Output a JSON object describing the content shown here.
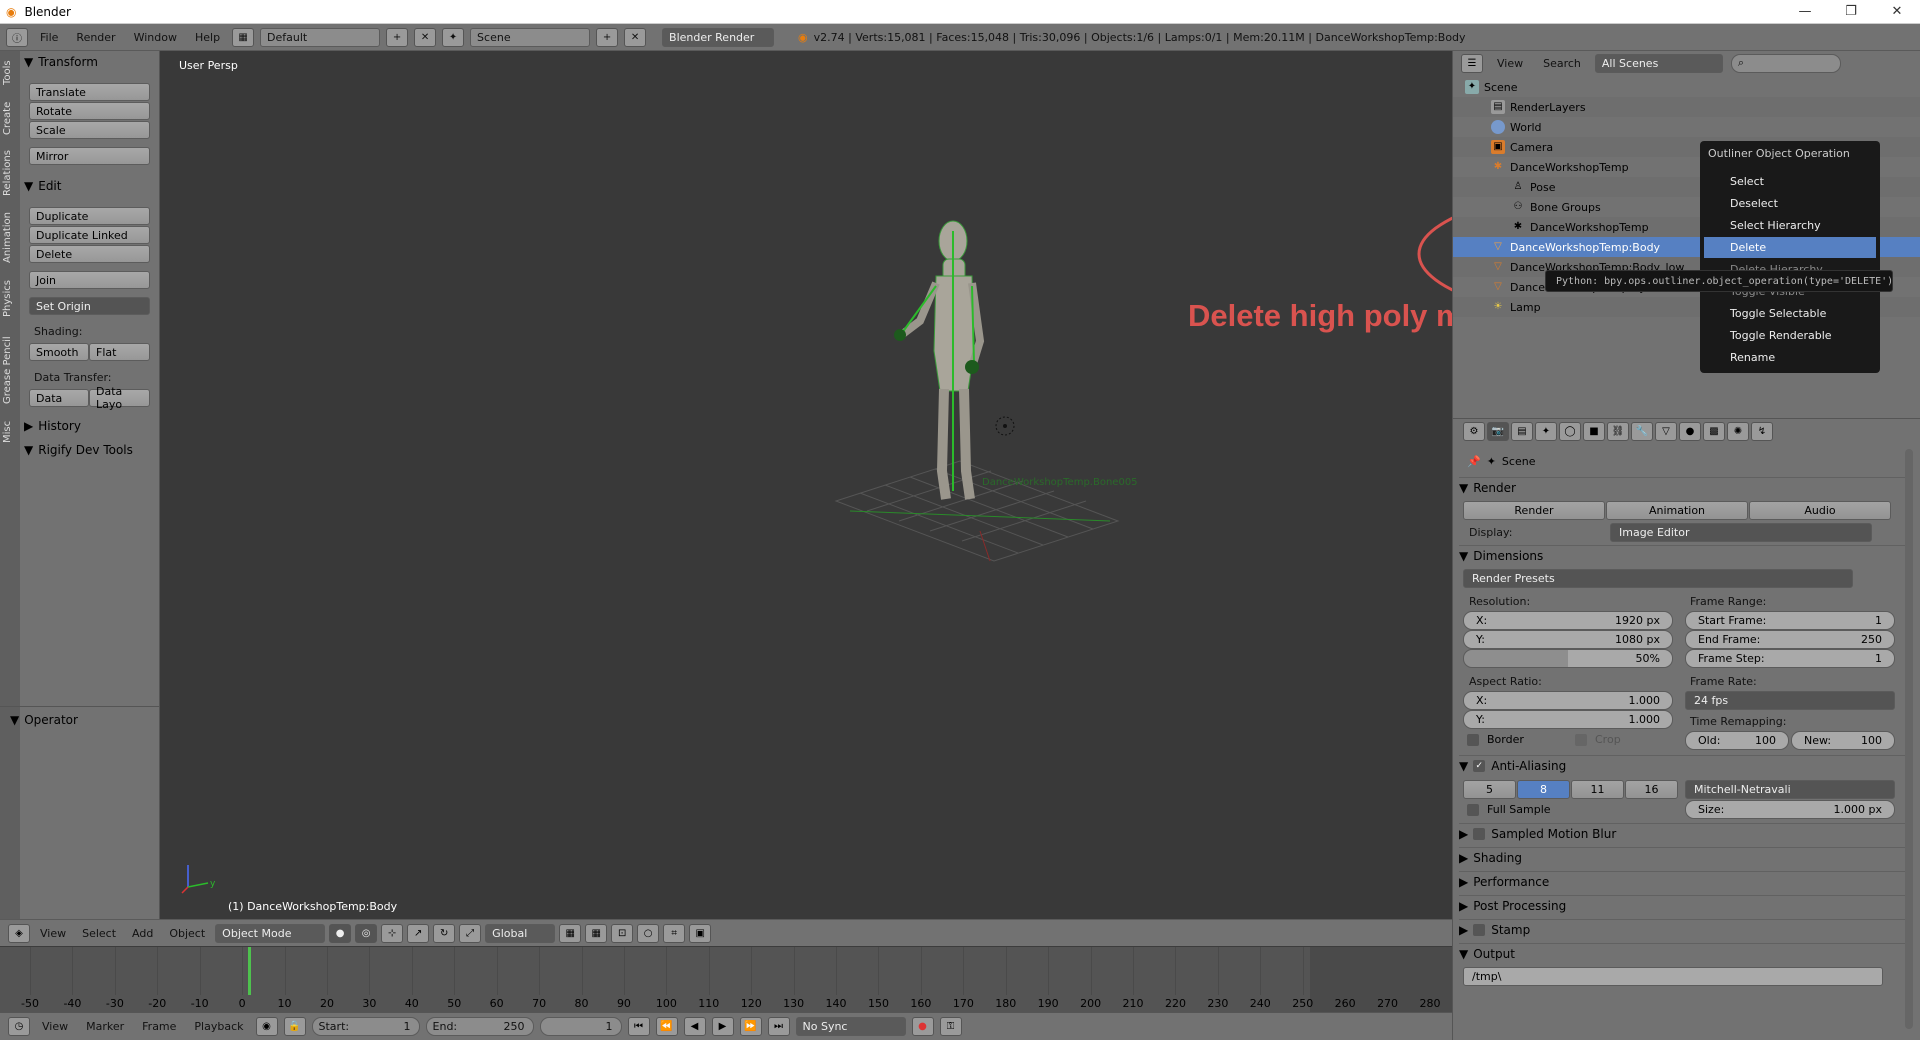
{
  "window": {
    "title": "Blender",
    "min": "—",
    "max": "❐",
    "close": "✕"
  },
  "infobar": {
    "menus": [
      "File",
      "Render",
      "Window",
      "Help"
    ],
    "layout": "Default",
    "scene": "Scene",
    "engine": "Blender Render",
    "stats": "v2.74 | Verts:15,081 | Faces:15,048 | Tris:30,096 | Objects:1/6 | Lamps:0/1 | Mem:20.11M | DanceWorkshopTemp:Body"
  },
  "toolshelf": {
    "tabs": [
      "Tools",
      "Create",
      "Relations",
      "Animation",
      "Physics",
      "Grease Pencil",
      "Misc"
    ],
    "transform": "Transform",
    "translate": "Translate",
    "rotate": "Rotate",
    "scale": "Scale",
    "mirror": "Mirror",
    "edit": "Edit",
    "duplicate": "Duplicate",
    "duplicate_linked": "Duplicate Linked",
    "delete": "Delete",
    "join": "Join",
    "set_origin": "Set Origin",
    "shading": "Shading:",
    "smooth": "Smooth",
    "flat": "Flat",
    "data_transfer": "Data Transfer:",
    "data": "Data",
    "data_layo": "Data Layo",
    "history": "History",
    "rigify": "Rigify Dev Tools",
    "operator": "Operator"
  },
  "viewport": {
    "persp": "User Persp",
    "object_label": "(1) DanceWorkshopTemp:Body",
    "annotation": "Delete high poly mesh",
    "axis_x": "x",
    "axis_y": "y",
    "axis_z": "z",
    "bone_label": "DanceWorkshopTemp.Bone005"
  },
  "vheader": {
    "view": "View",
    "select": "Select",
    "add": "Add",
    "object": "Object",
    "mode": "Object Mode",
    "orientation": "Global"
  },
  "timeline": {
    "ticks": [
      "-50",
      "-40",
      "-30",
      "-20",
      "-10",
      "0",
      "10",
      "20",
      "30",
      "40",
      "50",
      "60",
      "70",
      "80",
      "90",
      "100",
      "110",
      "120",
      "130",
      "140",
      "150",
      "160",
      "170",
      "180",
      "190",
      "200",
      "210",
      "220",
      "230",
      "240",
      "250",
      "260",
      "270",
      "280"
    ],
    "current_frame": 0
  },
  "tlheader": {
    "view": "View",
    "marker": "Marker",
    "frame": "Frame",
    "playback": "Playback",
    "start_label": "Start:",
    "start": "1",
    "end_label": "End:",
    "end": "250",
    "current": "1",
    "sync": "No Sync"
  },
  "outliner": {
    "view": "View",
    "search": "Search",
    "filter": "All Scenes",
    "rows": [
      "Scene",
      "RenderLayers",
      "World",
      "Camera",
      "DanceWorkshopTemp",
      "Pose",
      "Bone Groups",
      "DanceWorkshopTemp",
      "DanceWorkshopTemp:Body",
      "DanceWorkshopTemp:Body_low",
      "DanceWorkshopTemp:Eyes",
      "Lamp"
    ]
  },
  "context_menu": {
    "title": "Outliner Object Operation",
    "items": [
      "Select",
      "Deselect",
      "Select Hierarchy",
      "Delete",
      "Delete Hierarchy",
      "Toggle Visible",
      "Toggle Selectable",
      "Toggle Renderable",
      "Rename"
    ],
    "highlight": "Delete",
    "tooltip": "Python: bpy.ops.outliner.object_operation(type='DELETE')"
  },
  "props": {
    "scene": "Scene",
    "render": "Render",
    "render_btn": "Render",
    "animation_btn": "Animation",
    "audio_btn": "Audio",
    "display_label": "Display:",
    "display": "Image Editor",
    "dimensions": "Dimensions",
    "presets": "Render Presets",
    "resolution": "Resolution:",
    "res_x_label": "X:",
    "res_x": "1920 px",
    "res_y_label": "Y:",
    "res_y": "1080 px",
    "res_pct": "50%",
    "frame_range": "Frame Range:",
    "start_label": "Start Frame:",
    "start": "1",
    "end_label": "End Frame:",
    "end": "250",
    "step_label": "Frame Step:",
    "step": "1",
    "aspect": "Aspect Ratio:",
    "asp_x_label": "X:",
    "asp_x": "1.000",
    "asp_y_label": "Y:",
    "asp_y": "1.000",
    "frame_rate": "Frame Rate:",
    "fps": "24 fps",
    "time_remap": "Time Remapping:",
    "old_label": "Old:",
    "old": "100",
    "new_label": "New:",
    "new": "100",
    "border": "Border",
    "crop": "Crop",
    "aa": "Anti-Aliasing",
    "aa_samples": [
      "5",
      "8",
      "11",
      "16"
    ],
    "aa_selected": "8",
    "filter": "Mitchell-Netravali",
    "full_sample": "Full Sample",
    "size_label": "Size:",
    "size": "1.000 px",
    "sections": [
      "Sampled Motion Blur",
      "Shading",
      "Performance",
      "Post Processing",
      "Stamp",
      "Output"
    ],
    "output_path": "/tmp\\"
  }
}
